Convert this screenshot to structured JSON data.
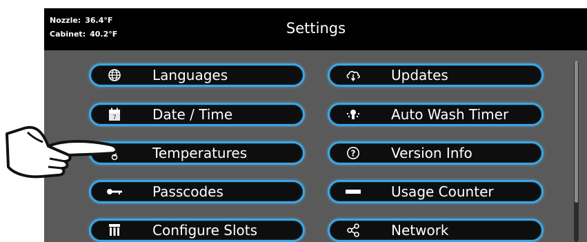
{
  "status": {
    "nozzle_label": "Nozzle:",
    "nozzle_value": "36.4°F",
    "cabinet_label": "Cabinet:",
    "cabinet_value": "40.2°F"
  },
  "header": {
    "title": "Settings"
  },
  "menu": {
    "left": [
      {
        "label": "Languages",
        "icon": "globe-icon"
      },
      {
        "label": "Date / Time",
        "icon": "calendar-icon"
      },
      {
        "label": "Temperatures",
        "icon": "thermometer-icon"
      },
      {
        "label": "Passcodes",
        "icon": "key-icon"
      },
      {
        "label": "Configure Slots",
        "icon": "slots-icon"
      }
    ],
    "right": [
      {
        "label": "Updates",
        "icon": "cloud-download-icon"
      },
      {
        "label": "Auto Wash Timer",
        "icon": "wash-icon"
      },
      {
        "label": "Version Info",
        "icon": "question-circle-icon"
      },
      {
        "label": "Usage Counter",
        "icon": "counter-bar-icon"
      },
      {
        "label": "Network",
        "icon": "share-icon"
      }
    ]
  },
  "colors": {
    "button_border": "#37a8e6",
    "button_fill": "#0e0e0e",
    "screen_background": "#5a5a5a",
    "header_background": "#000000",
    "text": "#ffffff"
  }
}
